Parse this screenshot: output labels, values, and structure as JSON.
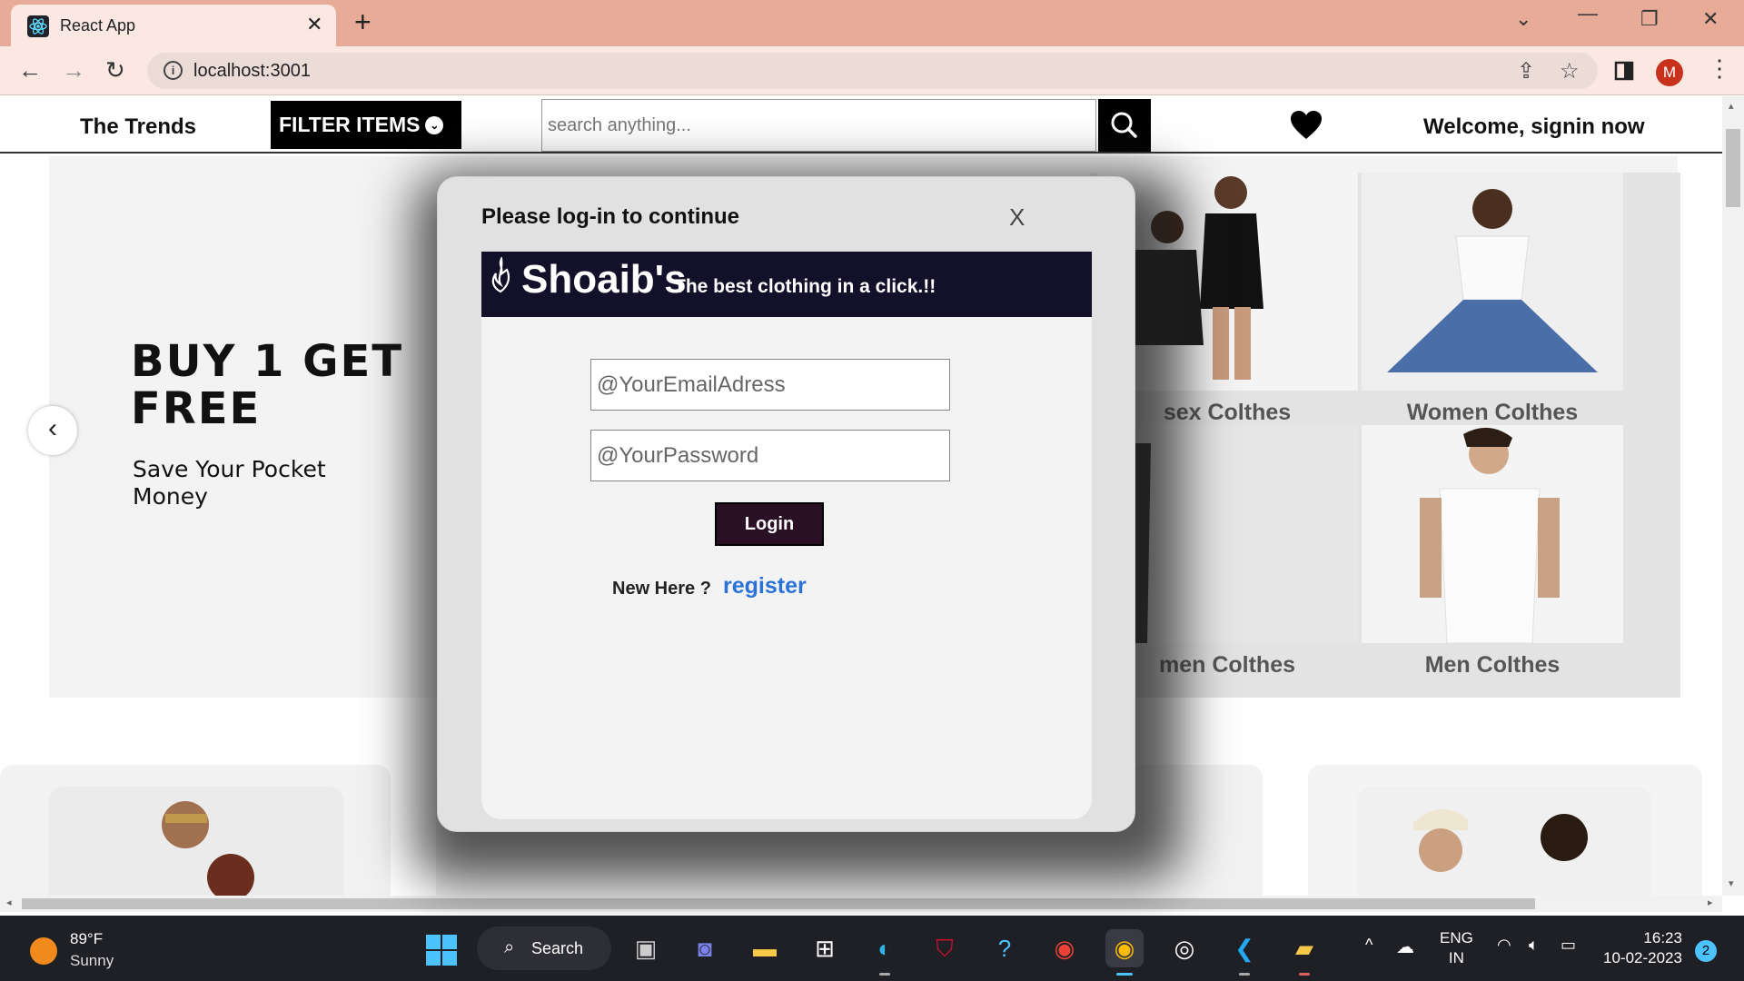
{
  "browser": {
    "tab_title": "React App",
    "tab_close": "✕",
    "new_tab": "+",
    "url": "localhost:3001",
    "profile_initial": "M",
    "info_glyph": "i"
  },
  "navbar": {
    "brand": "The Trends",
    "filter_label": "FILTER ITEMS",
    "filter_chevron": "⌄",
    "search_placeholder": "search anything...",
    "welcome": "Welcome, signin now"
  },
  "hero": {
    "headline": "BUY 1 GET FREE",
    "subline": "Save Your Pocket Money",
    "prev_arrow": "‹"
  },
  "categories": [
    {
      "label": "sex Colthes"
    },
    {
      "label": "Women Colthes"
    },
    {
      "label": "men Colthes"
    },
    {
      "label": "Men Colthes"
    }
  ],
  "modal": {
    "title": "Please log-in to continue",
    "close": "X",
    "brand_name": "Shoaib's",
    "tagline": "The best clothing in a click.!!",
    "email_placeholder": "@YourEmailAdress",
    "password_placeholder": "@YourPassword",
    "login_label": "Login",
    "new_here": "New Here ?",
    "register_label": "register"
  },
  "taskbar": {
    "temperature": "89°F",
    "condition": "Sunny",
    "search_label": "Search",
    "lang_top": "ENG",
    "lang_bottom": "IN",
    "time": "16:23",
    "date": "10-02-2023",
    "notifications": "2",
    "apps": [
      "file-explorer-icon",
      "teams-icon",
      "folder-icon",
      "store-icon",
      "edge-icon",
      "mcafee-icon",
      "help-icon",
      "chrome-icon",
      "chrome-active-icon",
      "github-icon",
      "vscode-icon",
      "onedrive-files-icon"
    ]
  },
  "colors": {
    "tab_strip": "#e8ab98",
    "modal_banner": "#131129",
    "login_button": "#2a1024",
    "register_link": "#2b72d6"
  }
}
